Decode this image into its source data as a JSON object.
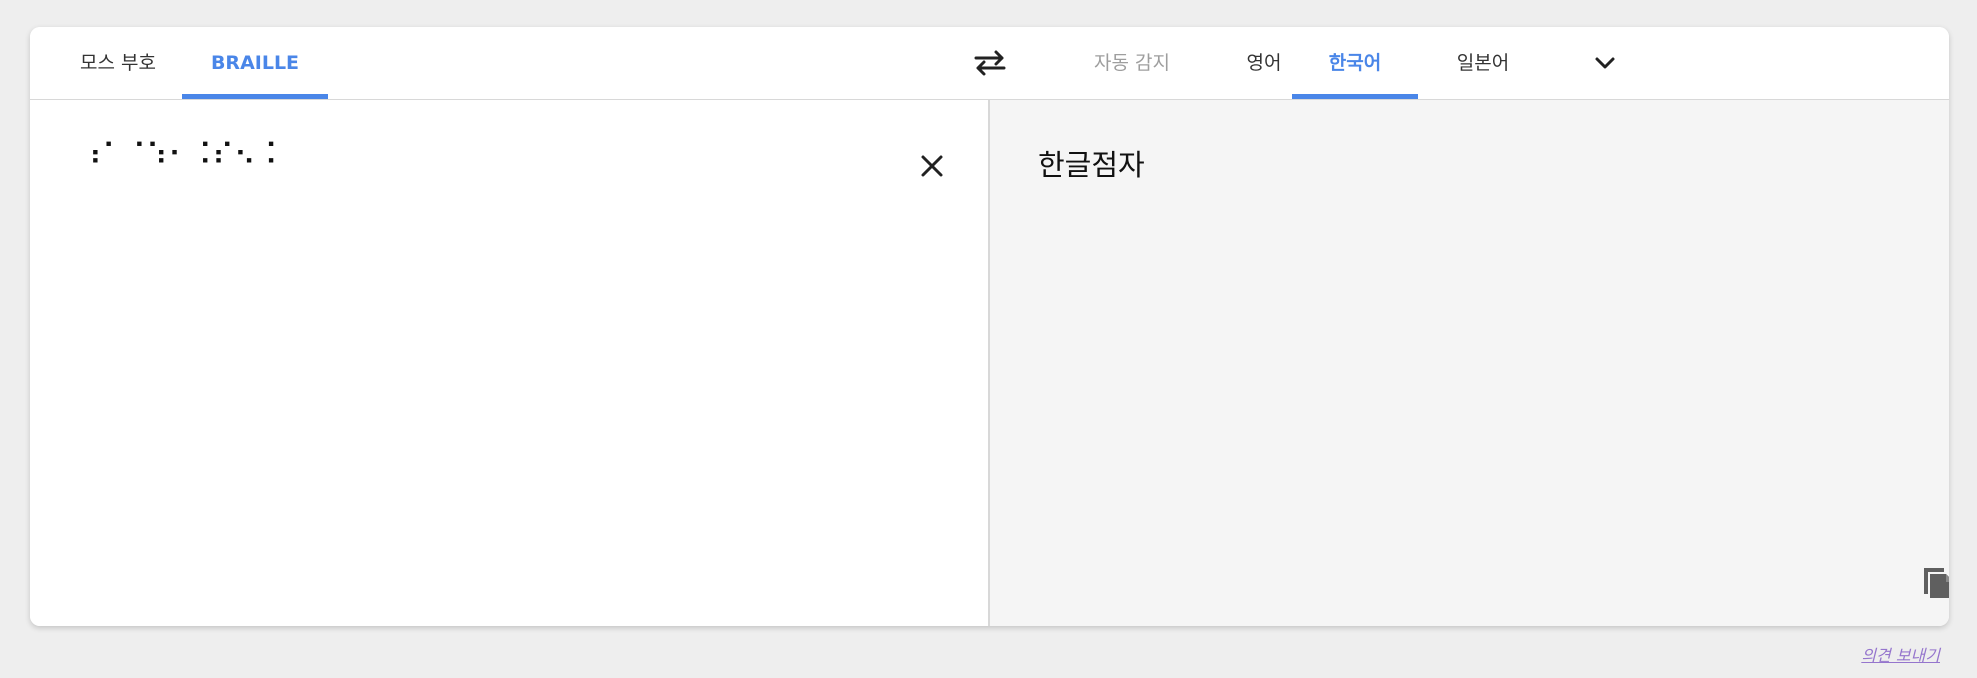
{
  "tabs": {
    "source": [
      {
        "label": "모스 부호"
      },
      {
        "label": "BRAILLE"
      }
    ],
    "target": [
      {
        "label": "자동 감지"
      },
      {
        "label": "영어"
      },
      {
        "label": "한국어"
      },
      {
        "label": "일본어"
      }
    ]
  },
  "icons": {
    "swap": "swap-arrows-icon",
    "more": "chevron-down-icon",
    "clear": "close-icon",
    "copy": "copy-icon"
  },
  "source": {
    "text": "⠰⠁⠈⠱⠂⠨⠎⠢⠨"
  },
  "result": {
    "text": "한글점자"
  },
  "feedback": {
    "label": "의견 보내기"
  },
  "colors": {
    "accent": "#4a86e8",
    "muted": "#9e9e9e",
    "feedback": "#9575cd",
    "right_pane_bg": "#f5f5f5"
  }
}
